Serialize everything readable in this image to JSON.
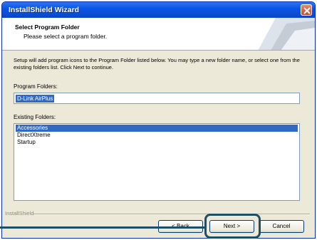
{
  "window": {
    "title": "InstallShield Wizard"
  },
  "header": {
    "title": "Select Program Folder",
    "subtitle": "Please select a program folder."
  },
  "body": {
    "description": "Setup will add program icons to the Program Folder listed below. You may type a new folder name, or select one from the existing folders list. Click Next to continue.",
    "program_folder_label": "Program Folders:",
    "program_folder_value": "D-Link AirPlus",
    "existing_folders_label": "Existing Folders:",
    "existing_folders": [
      "Accessories",
      "DirectXtreme",
      "Startup"
    ],
    "selected_folder": "Accessories"
  },
  "footer": {
    "brand": "InstallShield",
    "back_label": "< Back",
    "next_label": "Next >",
    "cancel_label": "Cancel"
  },
  "colors": {
    "titlebar": "#0a55e5",
    "highlight": "#1d4f66",
    "selection": "#316ac5"
  }
}
